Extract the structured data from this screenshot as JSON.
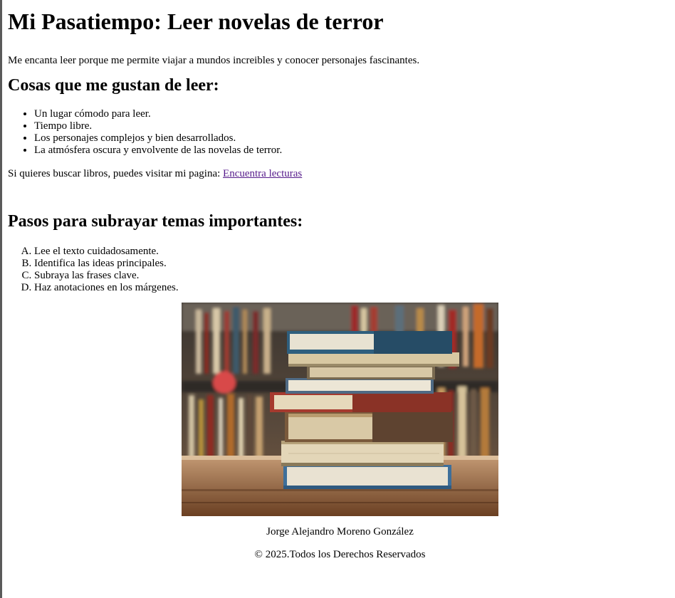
{
  "page": {
    "title": "Mi Pasatiempo: Leer novelas de terror",
    "intro": "Me encanta leer porque me permite viajar a mundos increibles y conocer personajes fascinantes."
  },
  "likes": {
    "heading": "Cosas que me gustan de leer:",
    "items": [
      "Un lugar cómodo para leer.",
      "Tiempo libre.",
      "Los personajes complejos y bien desarrollados.",
      "La atmósfera oscura y envolvente de las novelas de terror."
    ]
  },
  "search": {
    "text": "Si quieres buscar libros, puedes visitar mi pagina: ",
    "link_label": "Encuentra lecturas",
    "link_color": "#551a8b"
  },
  "steps": {
    "heading": "Pasos para subrayar temas importantes:",
    "items": [
      "Lee el texto cuidadosamente.",
      "Identifica las ideas principales.",
      "Subraya las frases clave.",
      "Haz anotaciones en los márgenes."
    ]
  },
  "image": {
    "alt": "stack-of-books-photo"
  },
  "footer": {
    "author": "Jorge Alejandro Moreno González",
    "copyright": "© 2025.Todos los Derechos Reservados"
  }
}
